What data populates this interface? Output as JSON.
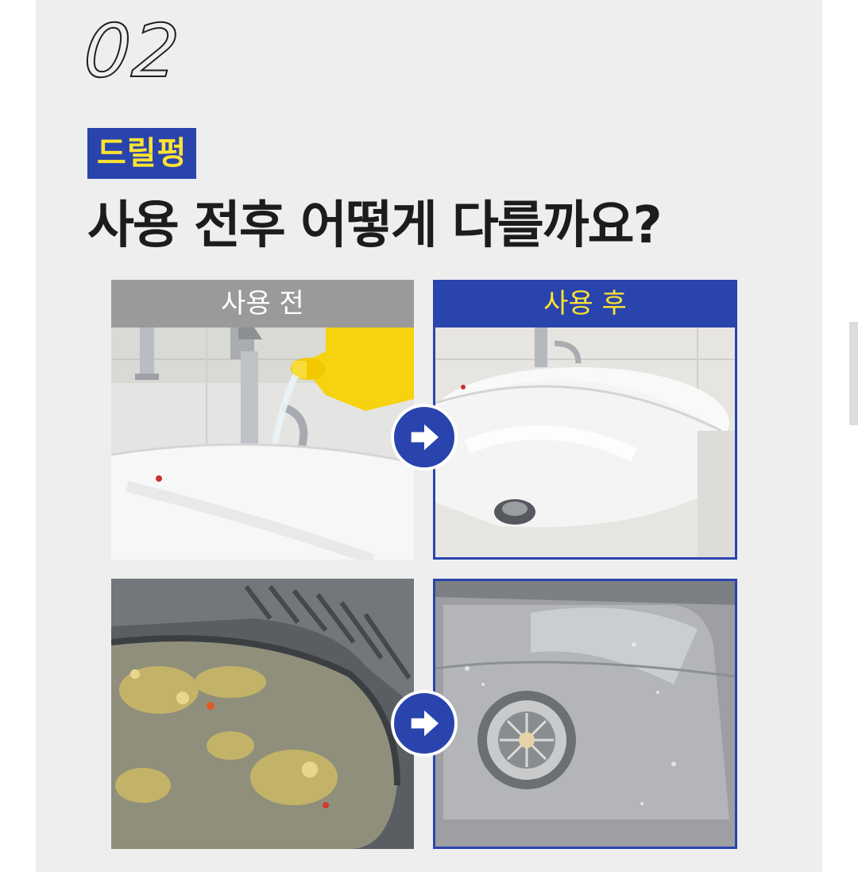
{
  "section": {
    "step_number": "02",
    "brand_tag": "드릴펑",
    "headline": "사용 전후 어떻게 다를까요?"
  },
  "comparison": {
    "before_label": "사용 전",
    "after_label": "사용 후"
  },
  "icons": {
    "arrow": "arrow-right-icon"
  },
  "colors": {
    "accent_blue": "#2a44ad",
    "accent_yellow": "#fde332",
    "before_gray": "#9a9a9a",
    "background": "#eeeeee"
  }
}
